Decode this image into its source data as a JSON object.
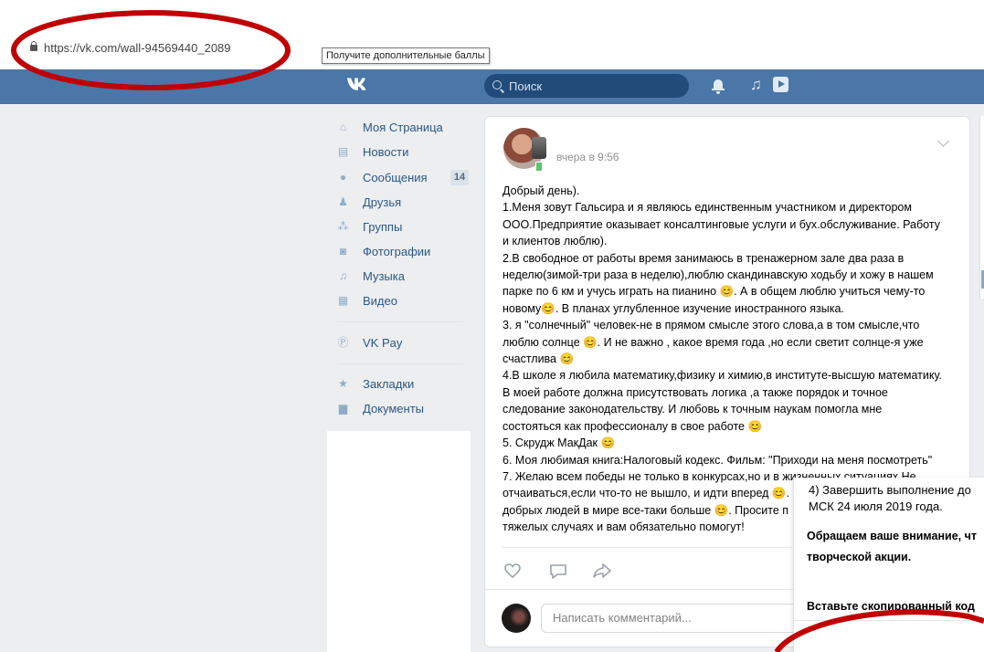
{
  "browser": {
    "url": "https://vk.com/wall-94569440_2089",
    "tooltip": "Получите дополнительные баллы"
  },
  "header": {
    "logo": "VK",
    "search_placeholder": "Поиск"
  },
  "sidebar": {
    "items": [
      {
        "label": "Моя Страница",
        "icon": "home-icon"
      },
      {
        "label": "Новости",
        "icon": "news-icon"
      },
      {
        "label": "Сообщения",
        "icon": "messages-icon",
        "badge": "14"
      },
      {
        "label": "Друзья",
        "icon": "friends-icon"
      },
      {
        "label": "Группы",
        "icon": "groups-icon"
      },
      {
        "label": "Фотографии",
        "icon": "camera-icon"
      },
      {
        "label": "Музыка",
        "icon": "music-icon"
      },
      {
        "label": "Видео",
        "icon": "video-icon"
      },
      {
        "label": "VK Pay",
        "icon": "vkpay-icon"
      },
      {
        "label": "Закладки",
        "icon": "star-icon"
      },
      {
        "label": "Документы",
        "icon": "document-icon"
      }
    ]
  },
  "post": {
    "time": "вчера в 9:56",
    "text": "Добрый день).\n1.Меня зовут Гальсира и я являюсь единственным участником и директором\nООО.Предприятие оказывает консалтинговые услуги и бух.обслуживание. Работу\nи клиентов люблю).\n2.В свободное от работы время занимаюсь в тренажерном зале два раза в\nнеделю(зимой-три раза в неделю),люблю скандинавскую ходьбу и хожу в нашем\nпарке по 6 км и учусь играть на пианино 😊. А в общем люблю учиться чему-то\nновому😊. В планах углубленное изучение иностранного языка.\n3. я \"солнечный\" человек-не в прямом смысле этого слова,а в том смысле,что\nлюблю солнце 😊. И не важно , какое время года ,но если светит солнце-я уже\nсчастлива 😊\n4.В школе я любила математику,физику и химию,в институте-высшую математику.\nВ моей работе должна присутствовать логика ,а также порядок и точное\nследование законодательству. И любовь к точным наукам помогла мне\nсостояться как профессионалу в свое работе 😊\n5. Скрудж МакДак 😊\n6. Моя любимая книга:Налоговый кодекс. Фильм: \"Приходи на меня посмотреть\"\n7. Желаю всем победы не только в конкурсах,но и в жизненных ситуациях.Не\nотчаиваться,если что-то не вышло, и идти вперед 😊.\nдобрых людей в мире все-таки больше 😊. Просите п\nтяжелых случаях и вам обязательно помогут!",
    "comment_placeholder": "Написать комментарий..."
  },
  "overlay": {
    "line1": "4) Завершить выполнение до",
    "line2": "МСК 24 июля 2019 года.",
    "bold1": "Обращаем ваше внимание, чт",
    "bold2": "творческой акции.",
    "bold3": "Вставьте скопированный код"
  },
  "colors": {
    "header": "#4a76a8",
    "annotation": "#c00000",
    "link": "#2a5885"
  }
}
